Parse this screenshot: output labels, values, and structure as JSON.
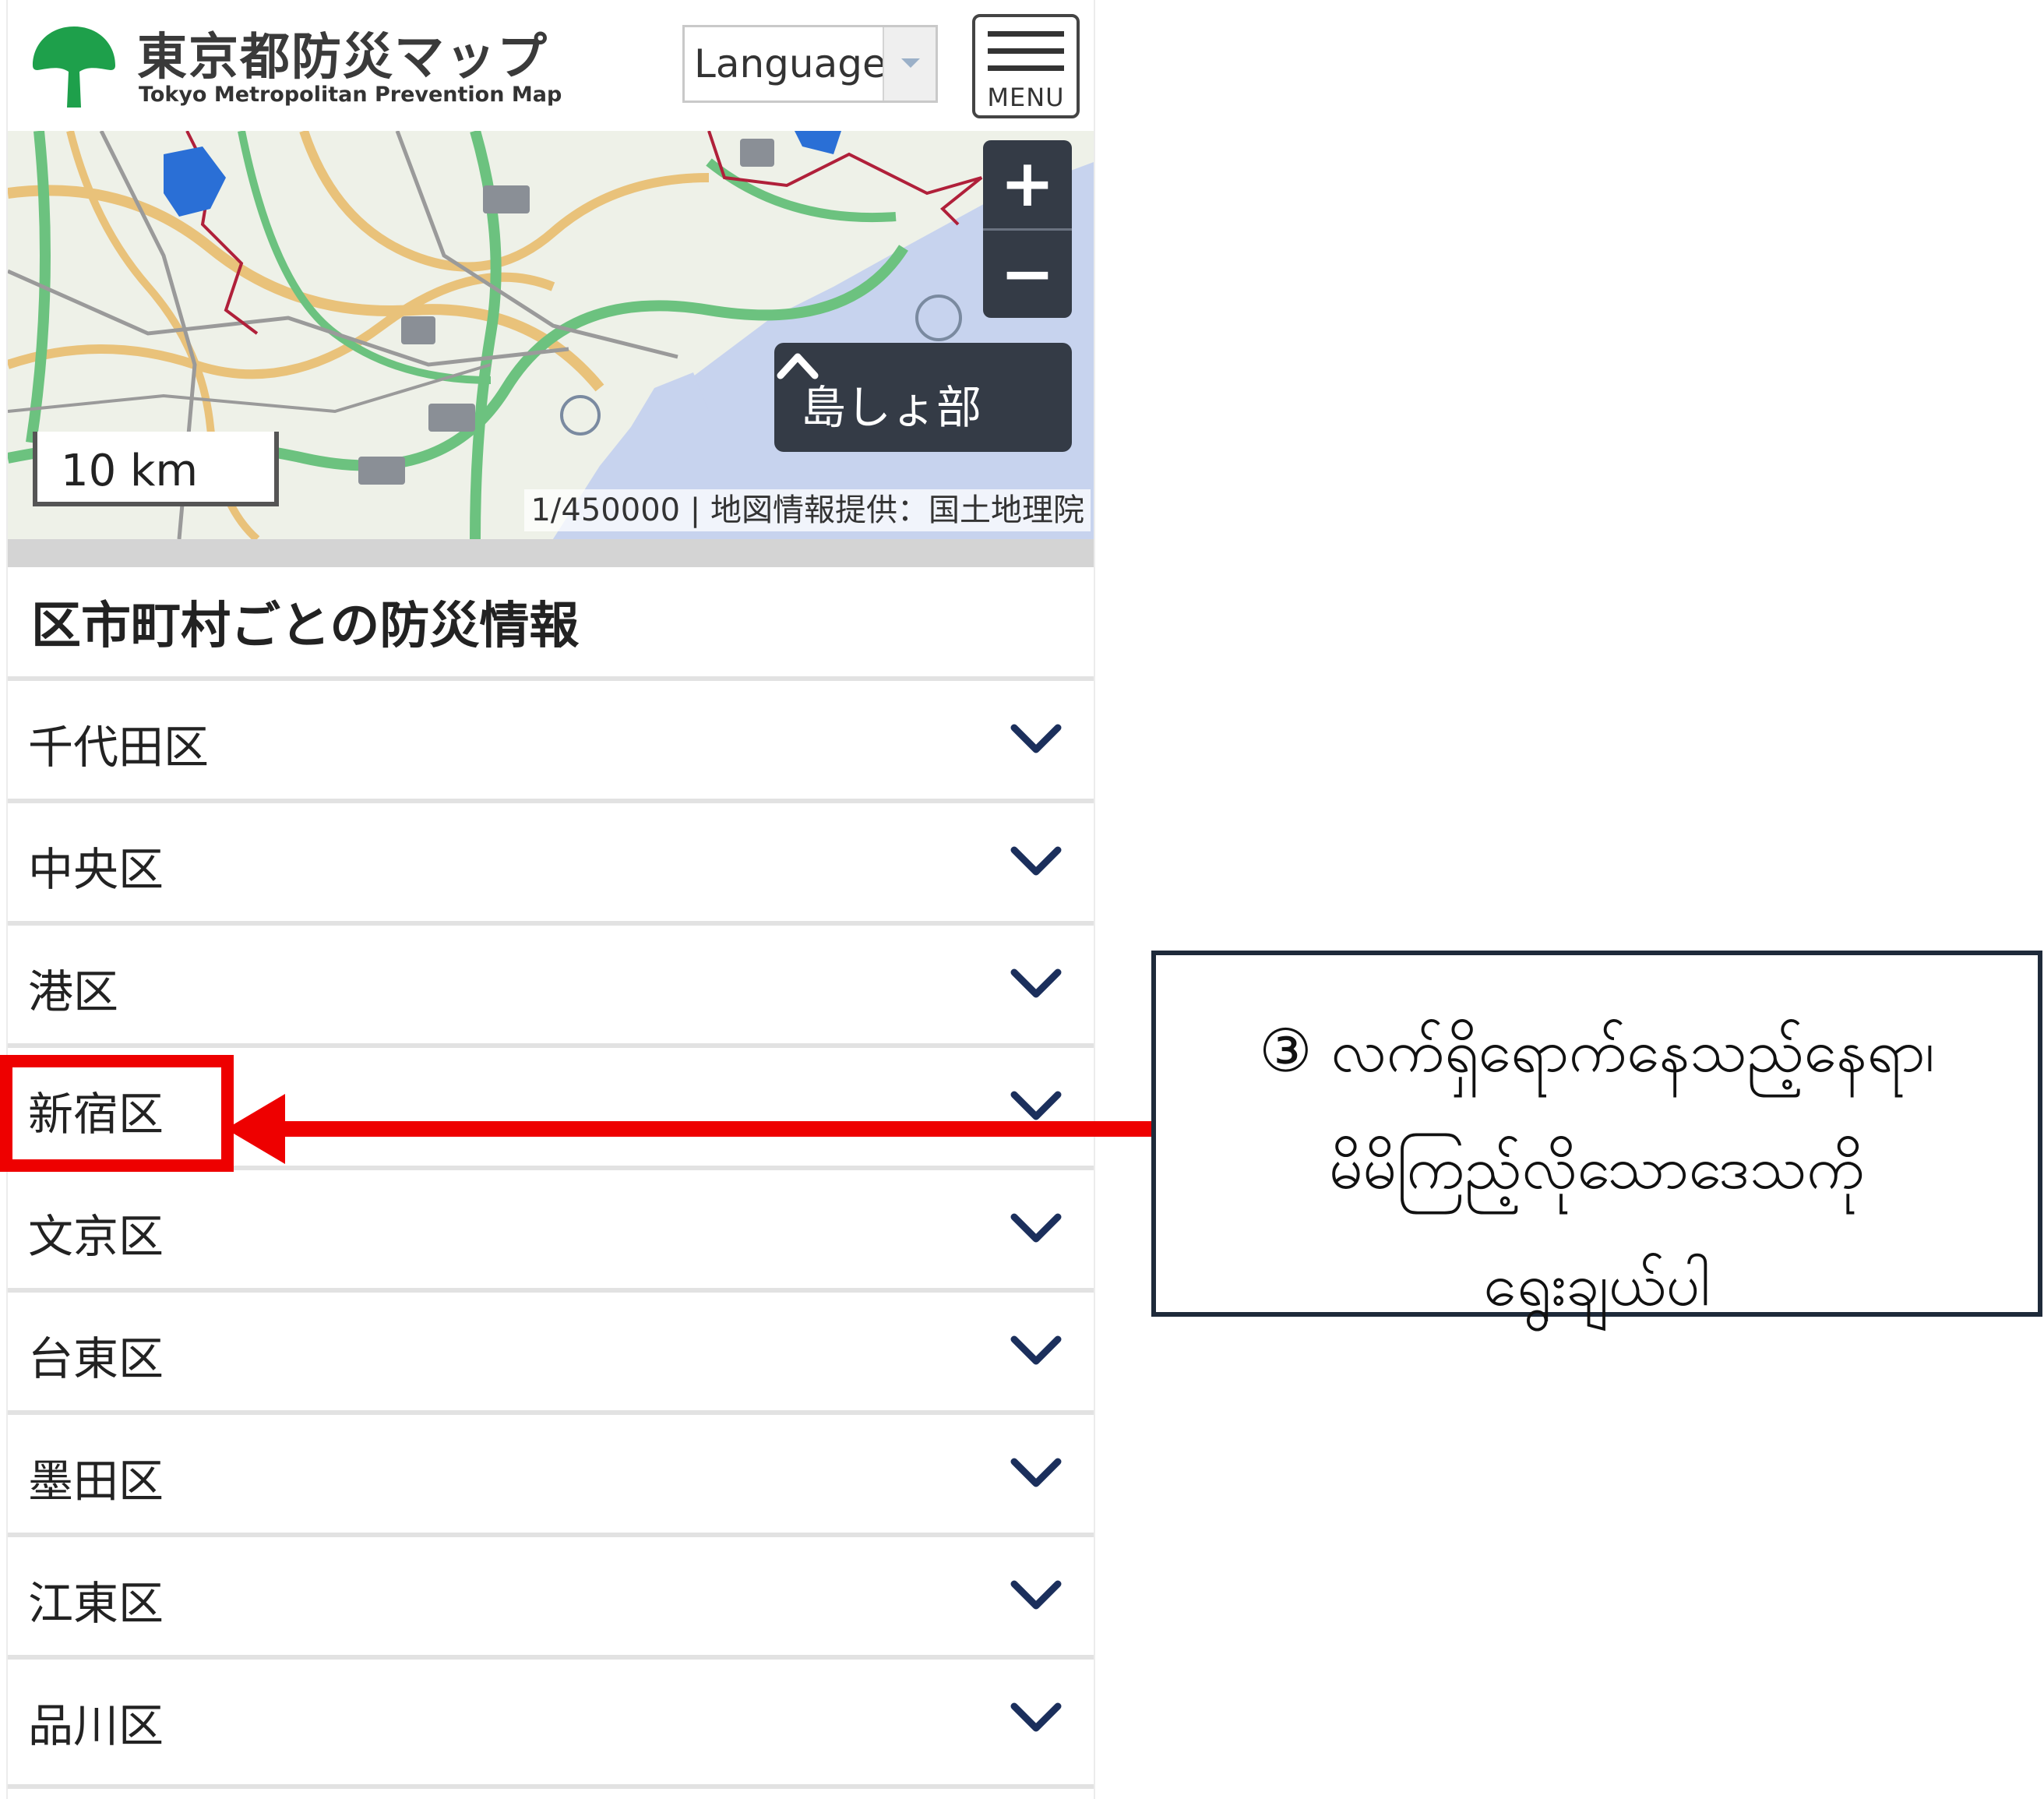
{
  "header": {
    "title": "東京都防災マップ",
    "subtitle": "Tokyo Metropolitan Prevention Map",
    "language_label": "Language",
    "menu_label": "MENU"
  },
  "map": {
    "zoom_in": "+",
    "zoom_out": "−",
    "island_button": "島しょ部",
    "scale_label": "10 km",
    "attribution": "1/450000 | 地図情報提供：国土地理院"
  },
  "section": {
    "title": "区市町村ごとの防災情報"
  },
  "wards": [
    {
      "label": "千代田区"
    },
    {
      "label": "中央区"
    },
    {
      "label": "港区"
    },
    {
      "label": "新宿区"
    },
    {
      "label": "文京区"
    },
    {
      "label": "台東区"
    },
    {
      "label": "墨田区"
    },
    {
      "label": "江東区"
    },
    {
      "label": "品川区"
    }
  ],
  "annotation": {
    "line1": "③ လက်ရှိရောက်နေသည့်နေရာ၊",
    "line2": "မိမိကြည့်လိုသောဒေသကို",
    "line3": "ရွေးချယ်ပါ",
    "highlight_color": "#ee0000"
  },
  "colors": {
    "brand_green": "#1ea04b",
    "dark_button": "#343b46",
    "chevron": "#1b2f5c"
  }
}
